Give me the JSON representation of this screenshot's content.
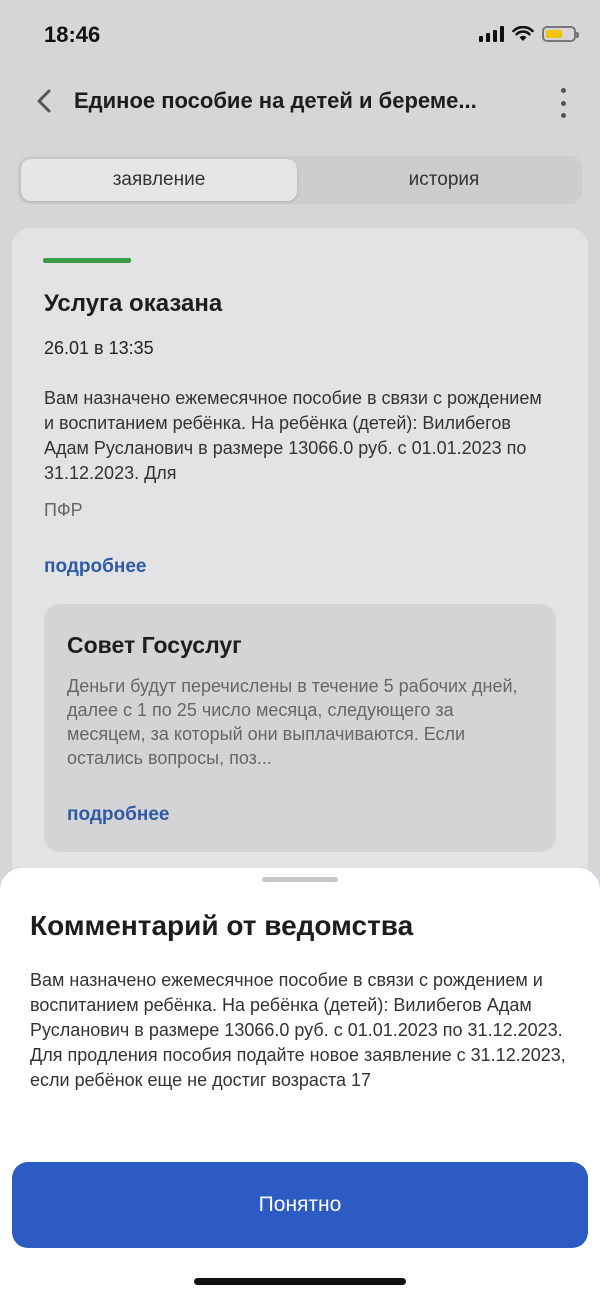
{
  "status_bar": {
    "time": "18:46",
    "battery_level": 0.6
  },
  "nav": {
    "title": "Единое пособие на детей и береме..."
  },
  "tabs": [
    {
      "label": "заявление",
      "active": true
    },
    {
      "label": "история",
      "active": false
    }
  ],
  "card": {
    "status": "Услуга оказана",
    "datetime": "26.01 в 13:35",
    "description": "Вам назначено ежемесячное пособие в связи с рождением и воспитанием ребёнка. На ребёнка (детей): Вилибегов Адам Русланович в размере 13066.0 руб. с 01.01.2023 по 31.12.2023. Для",
    "organization": "ПФР",
    "more_label": "подробнее",
    "accent_color": "#3a9d46"
  },
  "advice": {
    "title": "Совет Госуслуг",
    "text": "Деньги будут перечислены в течение 5 рабочих дней, далее с 1 по 25 число месяца, следующего за месяцем, за который они выплачиваются. Если остались вопросы, поз...",
    "more_label": "подробнее"
  },
  "sheet": {
    "title": "Комментарий от ведомства",
    "text": "Вам назначено ежемесячное пособие в связи с рождением и воспитанием ребёнка. На ребёнка (детей): Вилибегов Адам Русланович в размере 13066.0 руб. с 01.01.2023 по 31.12.2023. Для продления пособия подайте новое заявление с 31.12.2023, если ребёнок еще не достиг возраста 17",
    "button_label": "Понятно",
    "button_color": "#2d5bc4"
  }
}
